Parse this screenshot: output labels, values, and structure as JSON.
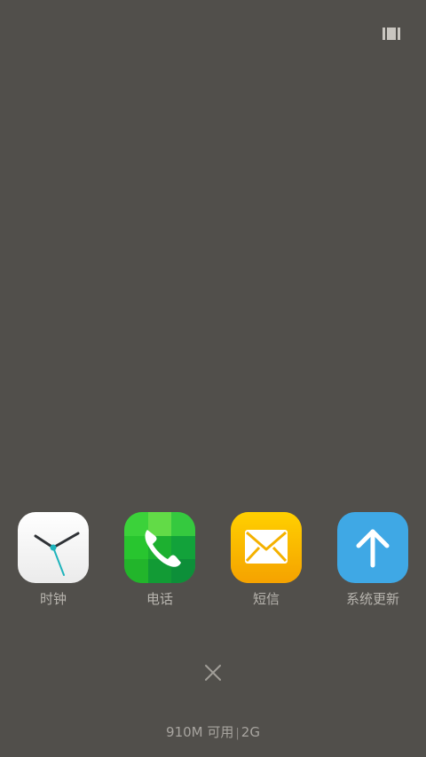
{
  "top": {
    "icon": "multi-window-icon"
  },
  "apps": [
    {
      "label": "时钟",
      "icon": "clock-icon",
      "color": "#ffffff"
    },
    {
      "label": "电话",
      "icon": "phone-icon",
      "color": "#1fbf28"
    },
    {
      "label": "短信",
      "icon": "message-icon",
      "color": "#f5b200"
    },
    {
      "label": "系统更新",
      "icon": "update-arrow-icon",
      "color": "#3fa8e5"
    }
  ],
  "close": {
    "icon": "close-icon"
  },
  "status": {
    "memory": "910M 可用",
    "total": "2G"
  },
  "colors": {
    "background": "#514f4b"
  }
}
